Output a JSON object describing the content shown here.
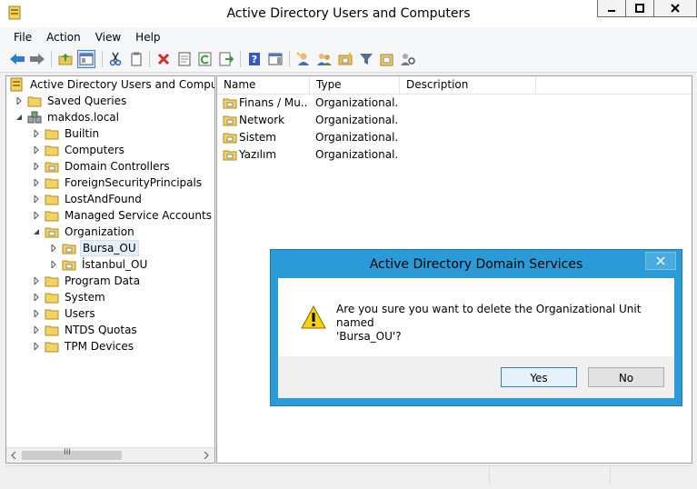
{
  "window": {
    "title": "Active Directory Users and Computers"
  },
  "menu": [
    "File",
    "Action",
    "View",
    "Help"
  ],
  "toolbar": {
    "icons": [
      "back-icon",
      "forward-icon",
      "up-folder-icon",
      "console-tree-icon",
      "cut-icon",
      "copy-icon",
      "delete-icon",
      "properties-icon",
      "refresh-icon",
      "export-list-icon",
      "help-icon",
      "action-pane-icon",
      "new-user-icon",
      "new-group-icon",
      "new-ou-icon",
      "filter-icon",
      "add-to-group-icon",
      "delegate-icon"
    ]
  },
  "tree": {
    "root": "Active Directory Users and Computers",
    "saved_queries": "Saved Queries",
    "domain": "makdos.local",
    "items": [
      "Builtin",
      "Computers",
      "Domain Controllers",
      "ForeignSecurityPrincipals",
      "LostAndFound",
      "Managed Service Accounts",
      "Organization"
    ],
    "org_children": [
      "Bursa_OU",
      "İstanbul_OU"
    ],
    "items_after": [
      "Program Data",
      "System",
      "Users",
      "NTDS Quotas",
      "TPM Devices"
    ],
    "scroll_label": "III"
  },
  "list": {
    "columns": [
      "Name",
      "Type",
      "Description"
    ],
    "rows": [
      {
        "name": "Finans / Mu...",
        "type": "Organizational...",
        "description": ""
      },
      {
        "name": "Network",
        "type": "Organizational...",
        "description": ""
      },
      {
        "name": "Sistem",
        "type": "Organizational...",
        "description": ""
      },
      {
        "name": "Yazılım",
        "type": "Organizational...",
        "description": ""
      }
    ]
  },
  "dialog": {
    "title": "Active Directory Domain Services",
    "message_line1": "Are you sure you want to delete the Organizational Unit named",
    "message_line2": "'Bursa_OU'?",
    "yes_label": "Yes",
    "no_label": "No"
  },
  "colors": {
    "dialog_frame": "#2a9bd6",
    "folder": "#e8c65b",
    "selection": "#e5f0fb"
  }
}
